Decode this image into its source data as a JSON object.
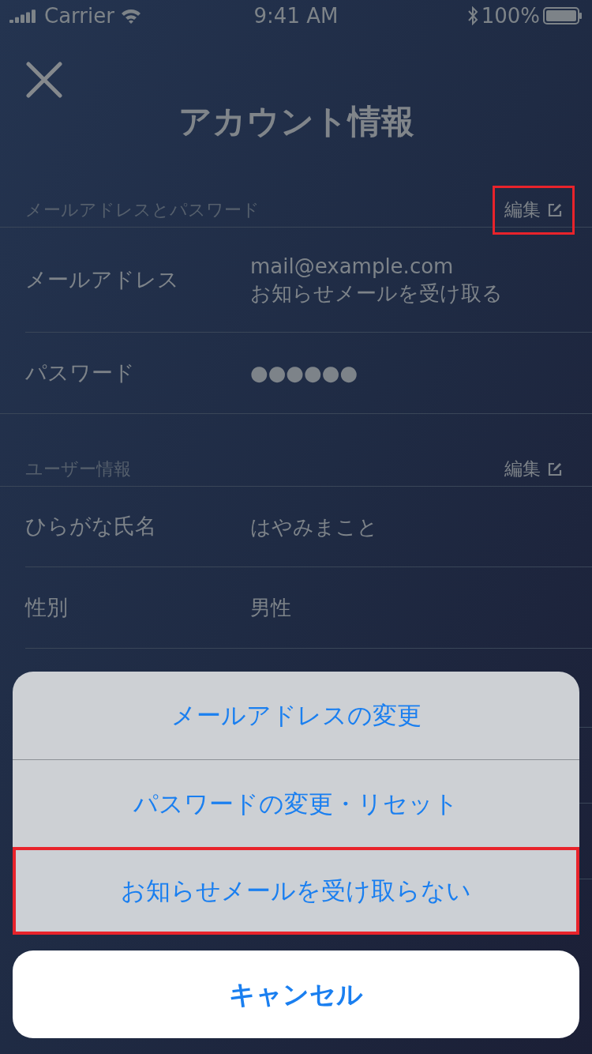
{
  "status_bar": {
    "carrier": "Carrier",
    "time": "9:41 AM",
    "battery": "100%"
  },
  "title": "アカウント情報",
  "sections": [
    {
      "header": "メールアドレスとパスワード",
      "edit": {
        "label": "編集",
        "highlighted": true
      },
      "rows": [
        {
          "label": "メールアドレス",
          "values": [
            "mail@example.com",
            "お知らせメールを受け取る"
          ]
        },
        {
          "label": "パスワード",
          "values": [
            "●●●●●●"
          ]
        }
      ]
    },
    {
      "header": "ユーザー情報",
      "edit": {
        "label": "編集",
        "highlighted": false
      },
      "rows": [
        {
          "label": "ひらがな氏名",
          "values": [
            "はやみまこと"
          ]
        },
        {
          "label": "性別",
          "values": [
            "男性"
          ]
        }
      ]
    }
  ],
  "action_sheet": {
    "actions": [
      {
        "label": "メールアドレスの変更",
        "highlighted": false
      },
      {
        "label": "パスワードの変更・リセット",
        "highlighted": false
      },
      {
        "label": "お知らせメールを受け取らない",
        "highlighted": true
      }
    ],
    "cancel": "キャンセル"
  }
}
